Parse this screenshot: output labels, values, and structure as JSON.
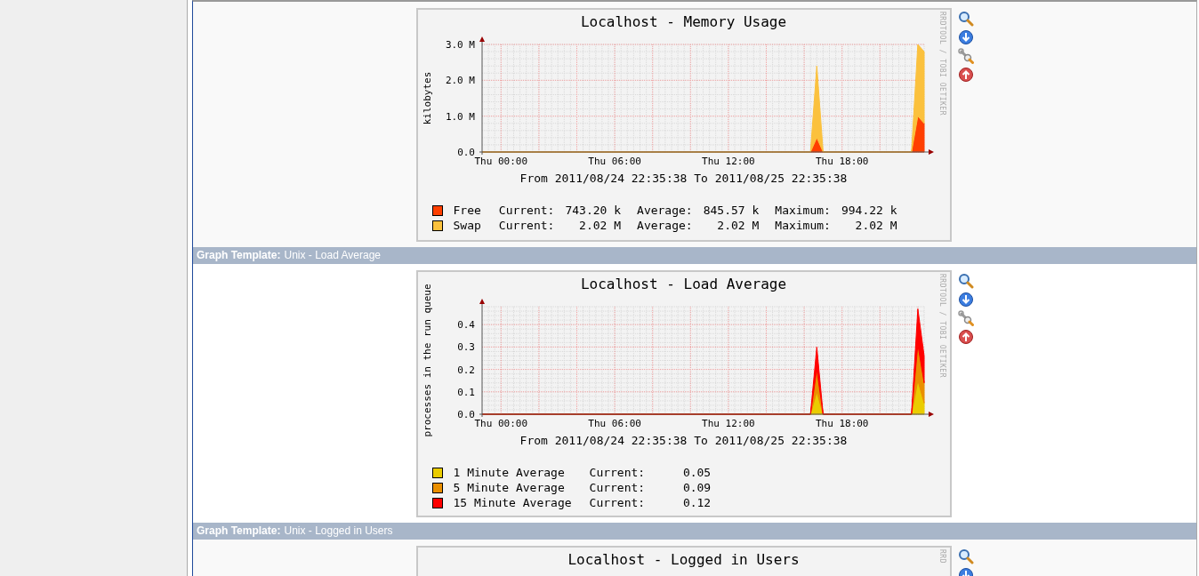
{
  "sections": [
    {
      "graph": {
        "title": "Localhost - Memory Usage",
        "credit": "RRDTOOL / TOBI OETIKER",
        "range": "From 2011/08/24 22:35:38 To 2011/08/25 22:35:38",
        "chart_data": {
          "type": "area",
          "ylabel": "kilobytes",
          "stacked": true,
          "grid": true,
          "ylim": [
            0,
            3
          ],
          "categories": [
            null,
            null,
            null,
            "Thu 00:00",
            null,
            null,
            null,
            null,
            null,
            null,
            null,
            null,
            null,
            null,
            null,
            null,
            null,
            null,
            null,
            null,
            null,
            "Thu 06:00",
            null,
            null,
            null,
            null,
            null,
            null,
            null,
            null,
            null,
            null,
            null,
            null,
            null,
            null,
            null,
            null,
            null,
            "Thu 12:00",
            null,
            null,
            null,
            null,
            null,
            null,
            null,
            null,
            null,
            null,
            null,
            null,
            null,
            null,
            null,
            null,
            null,
            "Thu 18:00",
            null,
            null,
            null,
            null,
            null,
            null,
            null,
            null,
            null,
            null,
            null,
            null,
            null
          ],
          "yticks": [
            {
              "value": 0,
              "label": "0.0"
            },
            {
              "value": 1,
              "label": "1.0 M"
            },
            {
              "value": 2,
              "label": "2.0 M"
            },
            {
              "value": 3,
              "label": "3.0 M"
            }
          ],
          "series": [
            {
              "name": "Free",
              "color": "#ff3f00",
              "values": [
                0,
                0,
                0,
                0,
                0,
                0,
                0,
                0,
                0,
                0,
                0,
                0,
                0,
                0,
                0,
                0,
                0,
                0,
                0,
                0,
                0,
                0,
                0,
                0,
                0,
                0,
                0,
                0,
                0,
                0,
                0,
                0,
                0,
                0,
                0,
                0,
                0,
                0,
                0,
                0,
                0,
                0,
                0,
                0,
                0,
                0,
                0,
                0,
                0,
                0,
                0,
                0,
                0,
                0.4,
                0,
                0,
                0,
                0,
                0,
                0,
                0,
                0,
                0,
                0,
                0,
                0,
                0,
                0,
                0,
                1.0,
                0.8
              ]
            },
            {
              "name": "Swap",
              "color": "#fbc13d",
              "values": [
                0,
                0,
                0,
                0,
                0,
                0,
                0,
                0,
                0,
                0,
                0,
                0,
                0,
                0,
                0,
                0,
                0,
                0,
                0,
                0,
                0,
                0,
                0,
                0,
                0,
                0,
                0,
                0,
                0,
                0,
                0,
                0,
                0,
                0,
                0,
                0,
                0,
                0,
                0,
                0,
                0,
                0,
                0,
                0,
                0,
                0,
                0,
                0,
                0,
                0,
                0,
                0,
                0,
                2.0,
                0,
                0,
                0,
                0,
                0,
                0,
                0,
                0,
                0,
                0,
                0,
                0,
                0,
                0,
                0,
                2.0,
                2.0
              ]
            }
          ]
        },
        "legend_stats": [
          [
            {
              "label": "Current:",
              "value": "743.20 k"
            },
            {
              "label": "Average:",
              "value": "845.57 k"
            },
            {
              "label": "Maximum:",
              "value": "994.22 k"
            }
          ],
          [
            {
              "label": "Current:",
              "value": "2.02 M"
            },
            {
              "label": "Average:",
              "value": "2.02 M"
            },
            {
              "label": "Maximum:",
              "value": "2.02 M"
            }
          ]
        ]
      }
    },
    {
      "header": {
        "label": "Graph Template:",
        "value": "Unix - Load Average"
      },
      "graph": {
        "title": "Localhost - Load Average",
        "credit": "RRDTOOL / TOBI OETIKER",
        "range": "From 2011/08/24 22:35:38 To 2011/08/25 22:35:38",
        "chart_data": {
          "type": "area",
          "ylabel": "processes in the run queue",
          "stacked": true,
          "grid": true,
          "ylim": [
            0,
            0.48
          ],
          "categories": [
            null,
            null,
            null,
            "Thu 00:00",
            null,
            null,
            null,
            null,
            null,
            null,
            null,
            null,
            null,
            null,
            null,
            null,
            null,
            null,
            null,
            null,
            null,
            "Thu 06:00",
            null,
            null,
            null,
            null,
            null,
            null,
            null,
            null,
            null,
            null,
            null,
            null,
            null,
            null,
            null,
            null,
            null,
            "Thu 12:00",
            null,
            null,
            null,
            null,
            null,
            null,
            null,
            null,
            null,
            null,
            null,
            null,
            null,
            null,
            null,
            null,
            null,
            "Thu 18:00",
            null,
            null,
            null,
            null,
            null,
            null,
            null,
            null,
            null,
            null,
            null,
            null,
            null
          ],
          "yticks": [
            {
              "value": 0,
              "label": "0.0"
            },
            {
              "value": 0.1,
              "label": "0.1"
            },
            {
              "value": 0.2,
              "label": "0.2"
            },
            {
              "value": 0.3,
              "label": "0.3"
            },
            {
              "value": 0.4,
              "label": "0.4"
            }
          ],
          "series": [
            {
              "name": "1 Minute Average",
              "color": "#eacc00",
              "values": [
                0,
                0,
                0,
                0,
                0,
                0,
                0,
                0,
                0,
                0,
                0,
                0,
                0,
                0,
                0,
                0,
                0,
                0,
                0,
                0,
                0,
                0,
                0,
                0,
                0,
                0,
                0,
                0,
                0,
                0,
                0,
                0,
                0,
                0,
                0,
                0,
                0,
                0,
                0,
                0,
                0,
                0,
                0,
                0,
                0,
                0,
                0,
                0,
                0,
                0,
                0,
                0,
                0,
                0.1,
                0,
                0,
                0,
                0,
                0,
                0,
                0,
                0,
                0,
                0,
                0,
                0,
                0,
                0,
                0,
                0.15,
                0.05
              ]
            },
            {
              "name": "5 Minute Average",
              "color": "#ea8f00",
              "values": [
                0,
                0,
                0,
                0,
                0,
                0,
                0,
                0,
                0,
                0,
                0,
                0,
                0,
                0,
                0,
                0,
                0,
                0,
                0,
                0,
                0,
                0,
                0,
                0,
                0,
                0,
                0,
                0,
                0,
                0,
                0,
                0,
                0,
                0,
                0,
                0,
                0,
                0,
                0,
                0,
                0,
                0,
                0,
                0,
                0,
                0,
                0,
                0,
                0,
                0,
                0,
                0,
                0,
                0.1,
                0,
                0,
                0,
                0,
                0,
                0,
                0,
                0,
                0,
                0,
                0,
                0,
                0,
                0,
                0,
                0.16,
                0.09
              ]
            },
            {
              "name": "15 Minute Average",
              "color": "#ff0000",
              "values": [
                0,
                0,
                0,
                0,
                0,
                0,
                0,
                0,
                0,
                0,
                0,
                0,
                0,
                0,
                0,
                0,
                0,
                0,
                0,
                0,
                0,
                0,
                0,
                0,
                0,
                0,
                0,
                0,
                0,
                0,
                0,
                0,
                0,
                0,
                0,
                0,
                0,
                0,
                0,
                0,
                0,
                0,
                0,
                0,
                0,
                0,
                0,
                0,
                0,
                0,
                0,
                0,
                0,
                0.1,
                0,
                0,
                0,
                0,
                0,
                0,
                0,
                0,
                0,
                0,
                0,
                0,
                0,
                0,
                0,
                0.16,
                0.12
              ]
            }
          ]
        },
        "legend_stats": [
          [
            {
              "label": "Current:",
              "value": "0.05"
            }
          ],
          [
            {
              "label": "Current:",
              "value": "0.09"
            }
          ],
          [
            {
              "label": "Current:",
              "value": "0.12"
            }
          ]
        ]
      }
    },
    {
      "header": {
        "label": "Graph Template:",
        "value": "Unix - Logged in Users"
      },
      "graph": {
        "title": "Localhost - Logged in Users",
        "credit": "RRD"
      }
    }
  ]
}
